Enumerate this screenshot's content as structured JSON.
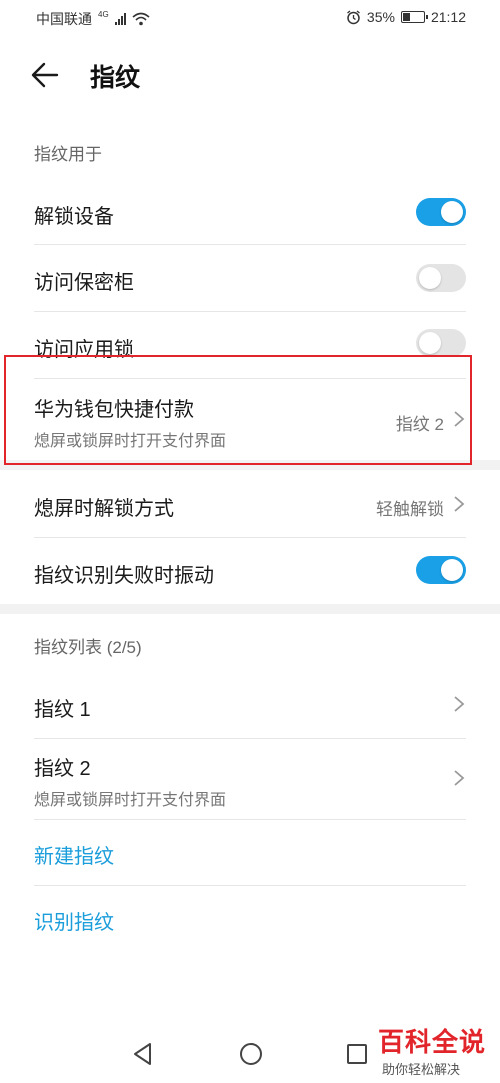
{
  "status_bar": {
    "carrier": "中国联通",
    "network": "4G",
    "battery": "35%",
    "battery_level": 0.35,
    "time": "21:12"
  },
  "header": {
    "title": "指纹"
  },
  "sections": {
    "usage_label": "指纹用于",
    "list_label": "指纹列表 (2/5)"
  },
  "settings": {
    "unlock_device": {
      "label": "解锁设备",
      "enabled": true
    },
    "access_safe": {
      "label": "访问保密柜",
      "enabled": false
    },
    "app_lock": {
      "label": "访问应用锁",
      "enabled": false
    },
    "huawei_wallet": {
      "label": "华为钱包快捷付款",
      "subtitle": "熄屏或锁屏时打开支付界面",
      "value": "指纹 2"
    },
    "screen_off_unlock": {
      "label": "熄屏时解锁方式",
      "value": "轻触解锁"
    },
    "fail_vibrate": {
      "label": "指纹识别失败时振动",
      "enabled": true
    }
  },
  "fingerprints": [
    {
      "label": "指纹 1",
      "subtitle": ""
    },
    {
      "label": "指纹 2",
      "subtitle": "熄屏或锁屏时打开支付界面"
    }
  ],
  "actions": {
    "new_fingerprint": "新建指纹",
    "identify_fingerprint": "识别指纹"
  },
  "watermark": {
    "title": "百科全说",
    "subtitle": "助你轻松解决"
  },
  "colors": {
    "accent": "#1aa0e6",
    "link": "#1a9ddb",
    "highlight": "#e2252b"
  }
}
